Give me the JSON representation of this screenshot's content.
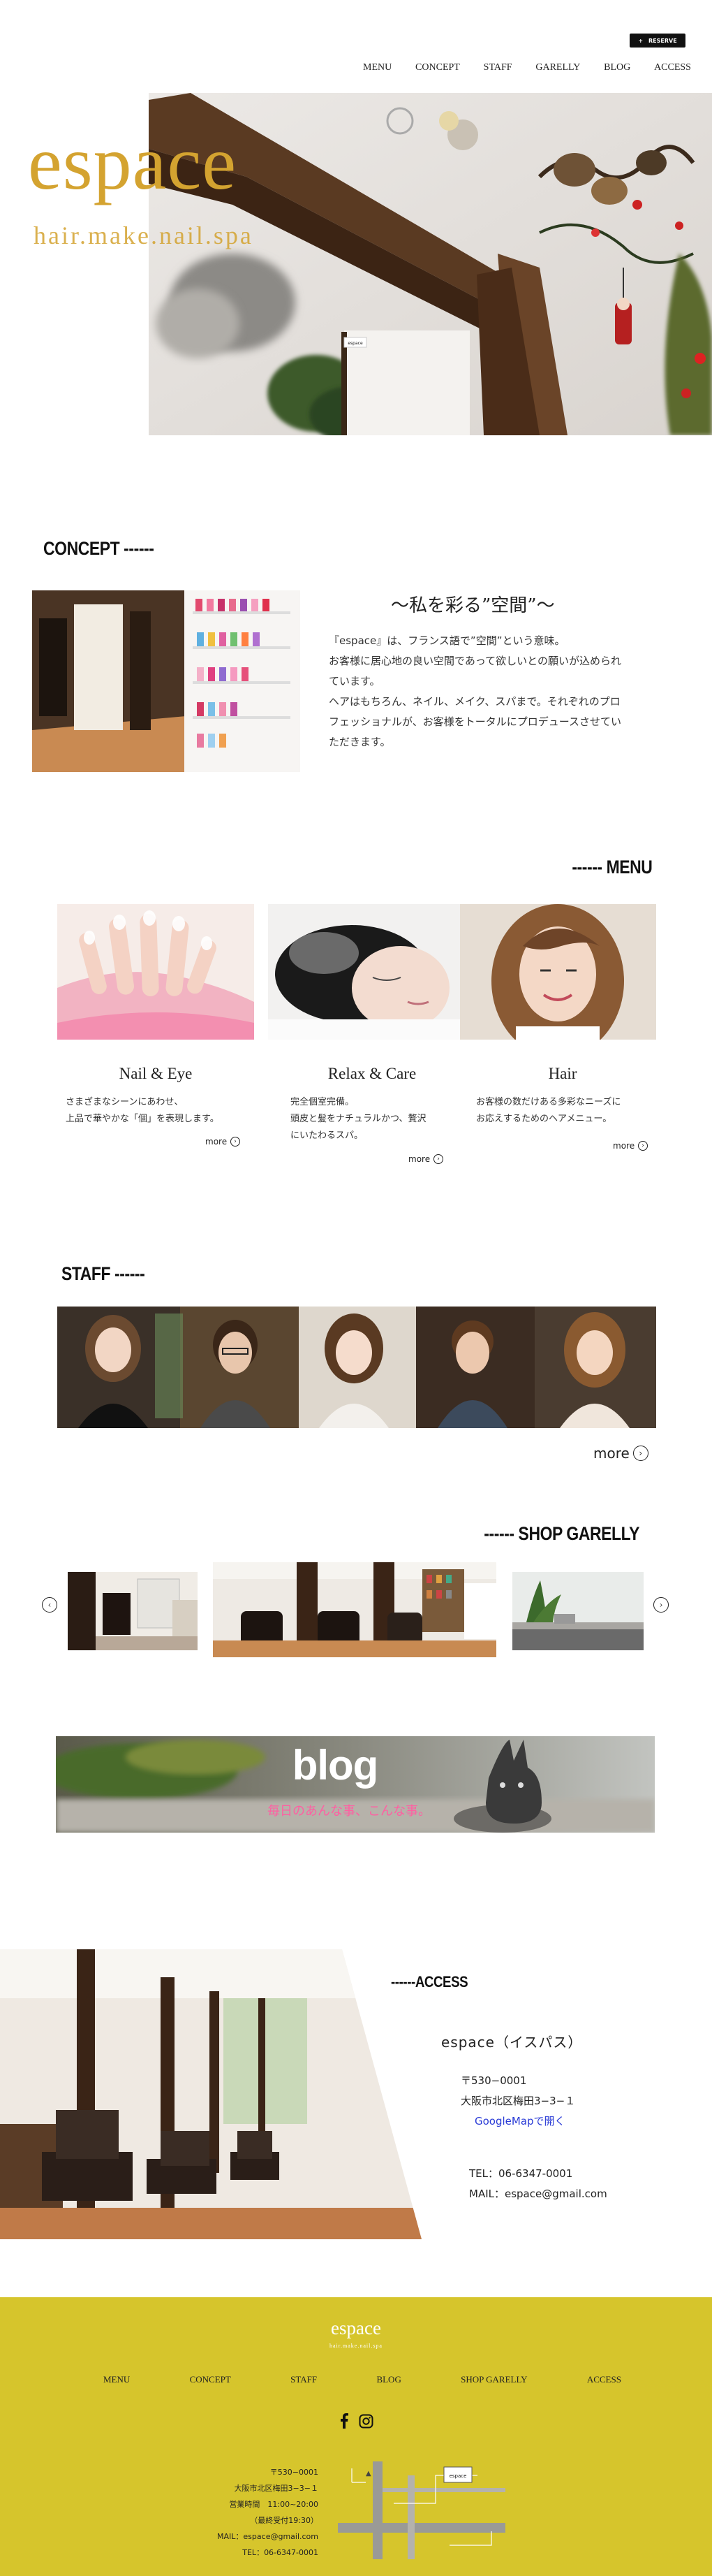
{
  "header": {
    "top_button": {
      "icon": "plus-icon",
      "label": "RESERVE"
    },
    "nav": [
      "MENU",
      "CONCEPT",
      "STAFF",
      "GARELLY",
      "BLOG",
      "ACCESS"
    ]
  },
  "hero": {
    "logo": "espace",
    "logo_sub": "hair.make.nail.spa",
    "sign": "espace"
  },
  "concept": {
    "title": "CONCEPT ------",
    "heading": "～私を彩る”空間”～",
    "lines": [
      "『espace』は、フランス語で”空間”という意味。",
      "お客様に居心地の良い空間であって欲しいとの願いが込められ",
      "ています。",
      "ヘアはもちろん、ネイル、メイク、スパまで。それぞれのプロ",
      "フェッショナルが、お客様をトータルにプロデュースさせてい",
      "ただきます。"
    ]
  },
  "menu": {
    "title": "------ MENU",
    "items": [
      {
        "name": "Nail & Eye",
        "desc": [
          "さまざまなシーンにあわせ、",
          "上品で華やかな「個」を表現します。"
        ],
        "more": "more"
      },
      {
        "name": "Relax & Care",
        "desc": [
          "完全個室完備。",
          "頭皮と髪をナチュラルかつ、贅沢",
          "にいたわるスパ。"
        ],
        "more": "more"
      },
      {
        "name": "Hair",
        "desc": [
          "お客様の数だけある多彩なニーズに",
          "お応えするためのヘアメニュー。"
        ],
        "more": "more"
      }
    ]
  },
  "staff": {
    "title": "STAFF ------",
    "more": "more"
  },
  "gallery": {
    "title": "------ SHOP GARELLY"
  },
  "blog": {
    "title": "blog",
    "subtitle": "毎日のあんな事、こんな事。"
  },
  "access": {
    "title": "------ACCESS",
    "shop_name": "espace（イスパス）",
    "postal": "〒530−0001",
    "address": "大阪市北区梅田3−3−１",
    "map_link": "GoogleMapで開く",
    "tel": "TEL：06-6347-0001",
    "mail": "MAIL：espace@gmail.com"
  },
  "footer": {
    "logo": "espace",
    "logo_sub": "hair.make.nail.spa",
    "nav": [
      "MENU",
      "CONCEPT",
      "STAFF",
      "BLOG",
      "SHOP GARELLY",
      "ACCESS"
    ],
    "social": [
      "facebook-icon",
      "instagram-icon"
    ],
    "info": [
      "〒530−0001",
      "大阪市北区梅田3−3−１",
      "営業時間　11:00~20:00",
      "（最終受付19:30）",
      "MAIL：espace@gmail.com",
      "TEL：06-6347-0001"
    ],
    "map_label": "espace"
  },
  "colors": {
    "accent_gold": "#d4a330",
    "footer_bg": "#d6c52c",
    "link_blue": "#2a3bd6",
    "blog_pink": "#ff5fa2"
  }
}
